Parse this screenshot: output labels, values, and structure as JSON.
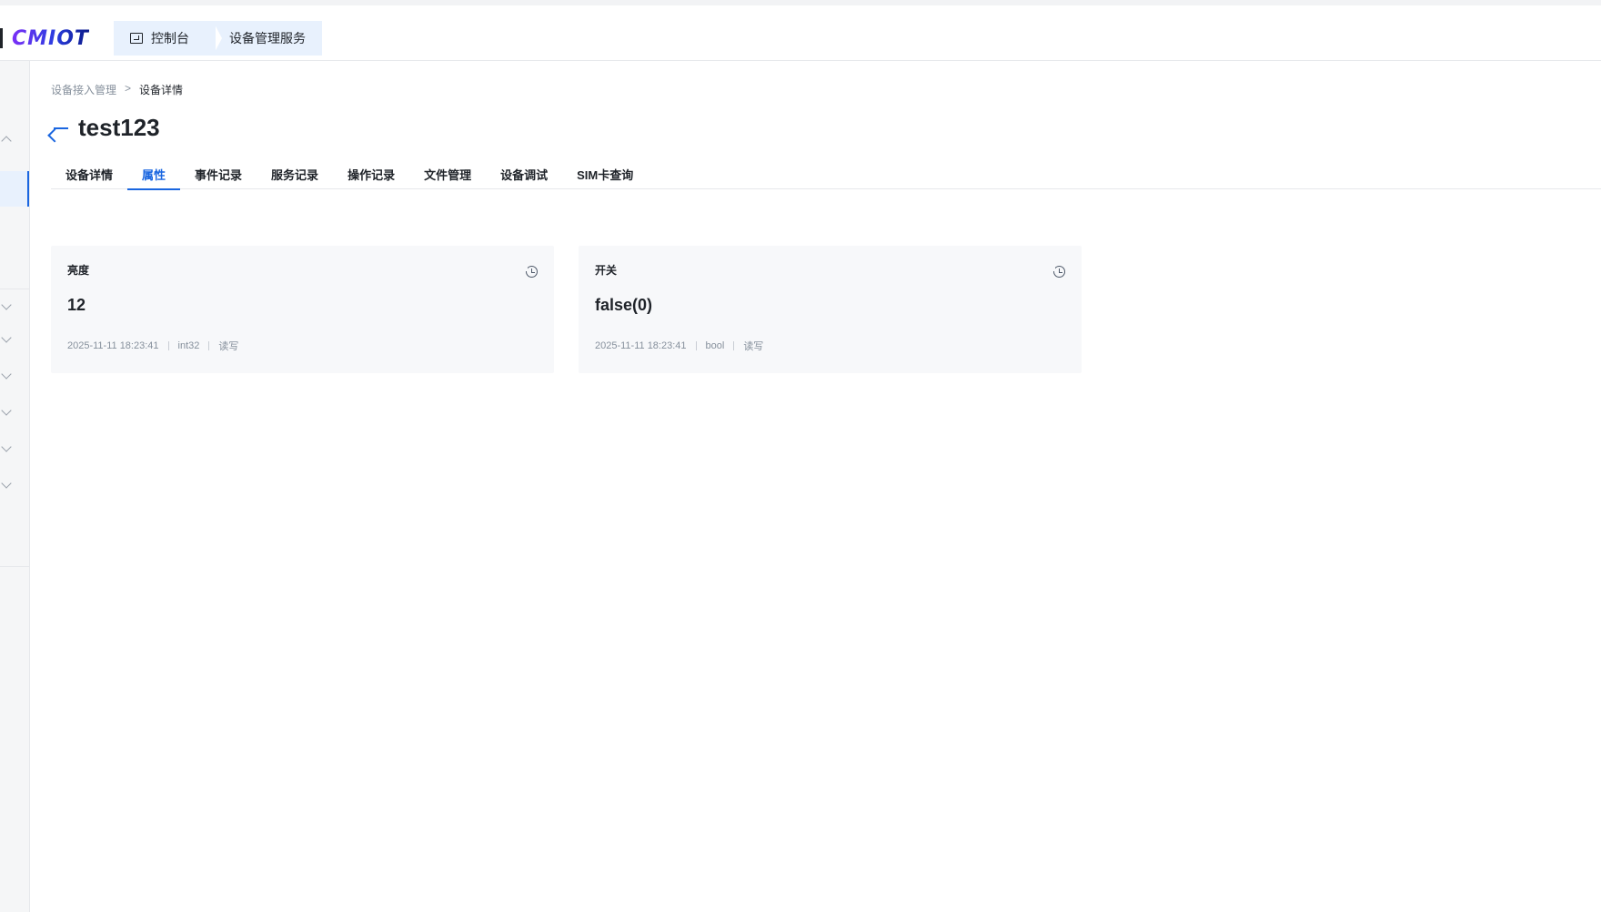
{
  "header": {
    "logo_text": "CMIOT",
    "crumbs": [
      {
        "label": "控制台"
      },
      {
        "label": "设备管理服务"
      }
    ]
  },
  "breadcrumb": {
    "parent": "设备接入管理",
    "separator": ">",
    "current": "设备详情"
  },
  "page": {
    "title": "test123"
  },
  "tabs": [
    {
      "label": "设备详情"
    },
    {
      "label": "属性"
    },
    {
      "label": "事件记录"
    },
    {
      "label": "服务记录"
    },
    {
      "label": "操作记录"
    },
    {
      "label": "文件管理"
    },
    {
      "label": "设备调试"
    },
    {
      "label": "SIM卡查询"
    }
  ],
  "active_tab_index": 1,
  "properties": [
    {
      "name": "亮度",
      "value": "12",
      "time": "2025-11-11 18:23:41",
      "type": "int32",
      "access": "读写",
      "icon": "history-icon"
    },
    {
      "name": "开关",
      "value": "false(0)",
      "time": "2025-11-11 18:23:41",
      "type": "bool",
      "access": "读写",
      "icon": "history-icon"
    }
  ],
  "colors": {
    "accent": "#1a66e0",
    "crumb_bg": "#e8f1fd",
    "card_bg": "#f7f8fa"
  }
}
